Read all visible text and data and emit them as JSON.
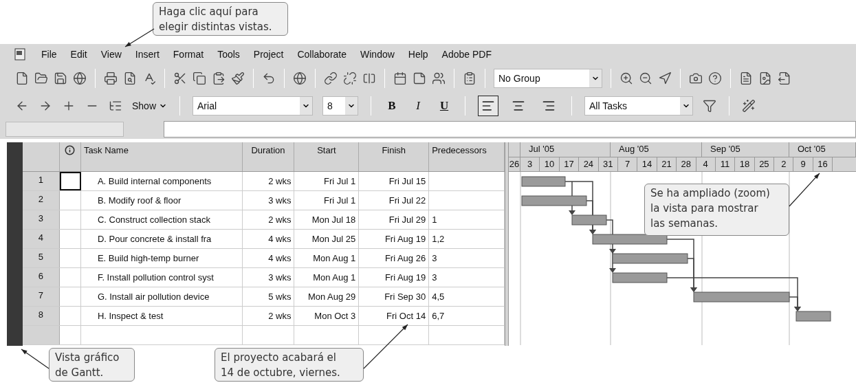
{
  "menu": [
    "File",
    "Edit",
    "View",
    "Insert",
    "Format",
    "Tools",
    "Project",
    "Collaborate",
    "Window",
    "Help",
    "Adobe PDF"
  ],
  "toolbar": {
    "group": "No Group"
  },
  "formatting_toolbar": {
    "show": "Show",
    "font": "Arial",
    "size": "8",
    "format_buttons": [
      {
        "kind": "bold",
        "label": "B"
      },
      {
        "kind": "italic",
        "label": "I"
      },
      {
        "kind": "underline",
        "label": "U"
      }
    ],
    "alignment": [
      {
        "kind": "left",
        "selected": true
      },
      {
        "kind": "center",
        "selected": false
      },
      {
        "kind": "right",
        "selected": false
      }
    ],
    "filter": "All Tasks"
  },
  "table": {
    "columns": [
      "Task Name",
      "Duration",
      "Start",
      "Finish",
      "Predecessors"
    ],
    "rows": [
      {
        "id": "1",
        "task": "A. Build internal components",
        "duration": "2 wks",
        "start": "Fri Jul 1",
        "finish": "Fri Jul 15",
        "selected": true
      },
      {
        "id": "2",
        "task": "B. Modify roof & floor",
        "duration": "3 wks",
        "start": "Fri Jul 1",
        "finish": "Fri Jul 22",
        "selected": false
      },
      {
        "id": "3",
        "task": "C. Construct collection stack",
        "duration": "2 wks",
        "start": "Mon Jul 18",
        "finish": "Fri Jul 29",
        "predecessors": "1",
        "selected": false
      },
      {
        "id": "4",
        "task": "D. Pour concrete & install fra",
        "duration": "4 wks",
        "start": "Mon Jul 25",
        "finish": "Fri Aug 19",
        "predecessors": "1,2",
        "selected": false
      },
      {
        "id": "5",
        "task": "E. Build high-temp burner",
        "duration": "4 wks",
        "start": "Mon Aug 1",
        "finish": "Fri Aug 26",
        "predecessors": "3",
        "selected": false
      },
      {
        "id": "6",
        "task": "F. Install pollution control syst",
        "duration": "3 wks",
        "start": "Mon Aug 1",
        "finish": "Fri Aug 19",
        "predecessors": "3",
        "selected": false
      },
      {
        "id": "7",
        "task": "G. Install air pollution device",
        "duration": "5 wks",
        "start": "Mon Aug 29",
        "finish": "Fri Sep 30",
        "predecessors": "4,5",
        "selected": false
      },
      {
        "id": "8",
        "task": "H. Inspect & test",
        "duration": "2 wks",
        "start": "Mon Oct 3",
        "finish": "Fri Oct 14",
        "predecessors": "6,7",
        "selected": false
      }
    ]
  },
  "timescale": {
    "months": [
      "Jul '05",
      "Aug '05",
      "Sep '05",
      "Oct '05"
    ],
    "weeks": [
      "26",
      "3",
      "10",
      "17",
      "24",
      "31",
      "7",
      "14",
      "21",
      "28",
      "4",
      "11",
      "18",
      "25",
      "2",
      "9",
      "16"
    ]
  },
  "callouts": [
    {
      "text": "Haga clic aquí para\nelegir distintas vistas."
    },
    {
      "text": "Se ha ampliado (zoom)\nla vista para mostrar\nlas semanas."
    },
    {
      "text": "Vista gráfico\nde Gantt."
    },
    {
      "text": "El proyecto acabará el\n14 de octubre, viernes."
    }
  ]
}
